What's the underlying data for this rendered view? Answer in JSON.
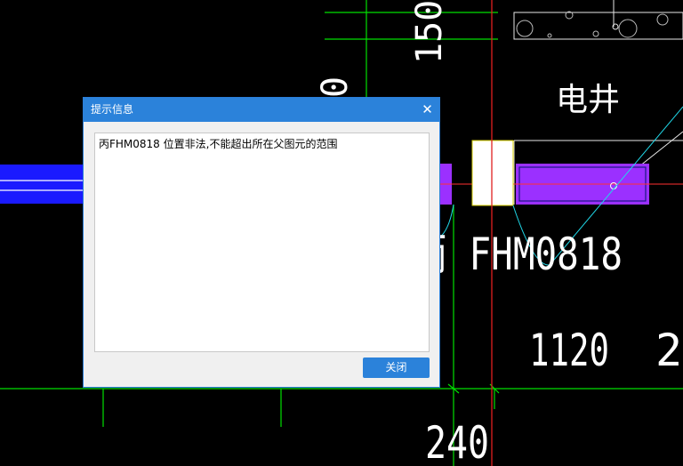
{
  "dialog": {
    "title": "提示信息",
    "close_glyph": "✕",
    "message": "丙FHM0818 位置非法,不能超出所在父图元的范围",
    "ok_label": "关闭"
  },
  "drawing": {
    "dim_150": "150",
    "label_elec_shaft": "电井",
    "door_label": "丙 FHM0818",
    "dim_1120": "1120",
    "dim_2_partial": "2",
    "dim_240": "240"
  },
  "colors": {
    "background": "#000000",
    "grid_green": "#00e000",
    "axis_red": "#e02020",
    "wall_blue": "#1a1aff",
    "wall_purple": "#9b30ff",
    "dialog_blue": "#2b82da"
  }
}
